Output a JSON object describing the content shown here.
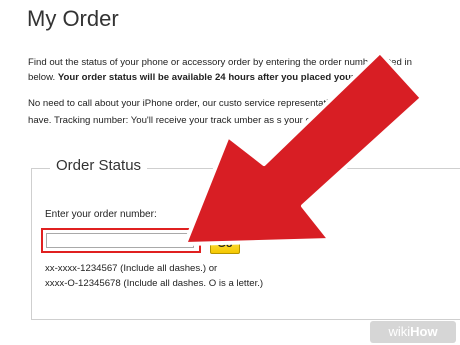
{
  "page": {
    "title": "My Order"
  },
  "intro": {
    "line1": "Find out the status of your phone or accessory order by entering the order number listed in",
    "line2_plain": "below. ",
    "line2_bold": "Your order status will be available 24 hours after you placed your order."
  },
  "note": {
    "line1": "No need to call about your iPhone order, our custo      service representatives have the sa",
    "line2": "have. Tracking number: You'll receive your track       umber as s         your order ships."
  },
  "order_status": {
    "legend": "Order Status",
    "field_label": "Enter your order number:",
    "input_value": "",
    "input_placeholder": "",
    "go_label": "Go",
    "hint1": "xx-xxxx-1234567 (Include all dashes.) or",
    "hint2": "xxxx-O-12345678 (Include all dashes. O is a letter.)"
  },
  "watermark": {
    "wiki": "wiki",
    "how": "How"
  },
  "colors": {
    "arrow_fill": "#d81e24",
    "arrow_outline": "#ffffff",
    "highlight_border": "#e02020",
    "go_button": "#f5c800"
  },
  "icons": {
    "arrow": "red-pointer-arrow-icon"
  }
}
